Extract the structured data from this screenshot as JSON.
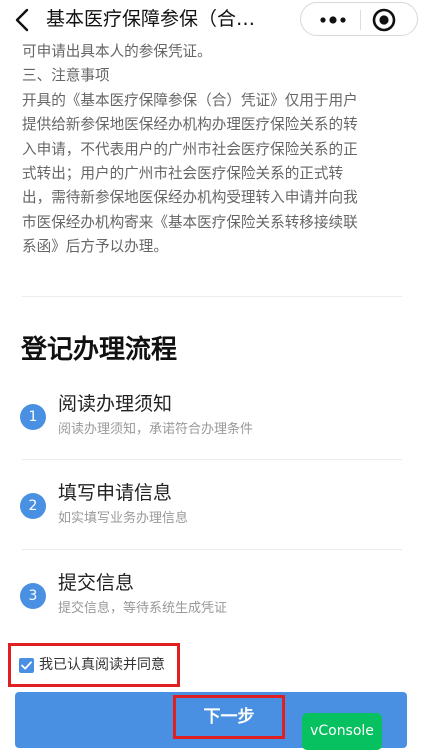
{
  "nav": {
    "title": "基本医疗保障参保（合…"
  },
  "notice": {
    "lines": [
      "可申请出具本人的参保凭证。",
      "三、注意事项",
      "开具的《基本医疗保障参保（合）凭证》仅用于用户",
      "提供给新参保地医保经办机构办理医疗保险关系的转",
      "入申请，不代表用户的广州市社会医疗保险关系的正",
      "式转出；用户的广州市社会医疗保险关系的正式转",
      "出，需待新参保地医保经办机构受理转入申请并向我",
      "市医保经办机构寄来《基本医疗保险关系转移接续联",
      "系函》后方予以办理。"
    ]
  },
  "flow": {
    "title": "登记办理流程",
    "steps": [
      {
        "num": "1",
        "title": "阅读办理须知",
        "desc": "阅读办理须知，承诺符合办理条件"
      },
      {
        "num": "2",
        "title": "填写申请信息",
        "desc": "如实填写业务办理信息"
      },
      {
        "num": "3",
        "title": "提交信息",
        "desc": "提交信息，等待系统生成凭证"
      }
    ]
  },
  "agree": {
    "label": "我已认真阅读并同意",
    "checked": true
  },
  "actions": {
    "next_label": "下一步"
  },
  "debug": {
    "vconsole_label": "vConsole"
  },
  "colors": {
    "accent": "#4a90e2",
    "highlight": "#e02020",
    "vconsole": "#07c160"
  }
}
